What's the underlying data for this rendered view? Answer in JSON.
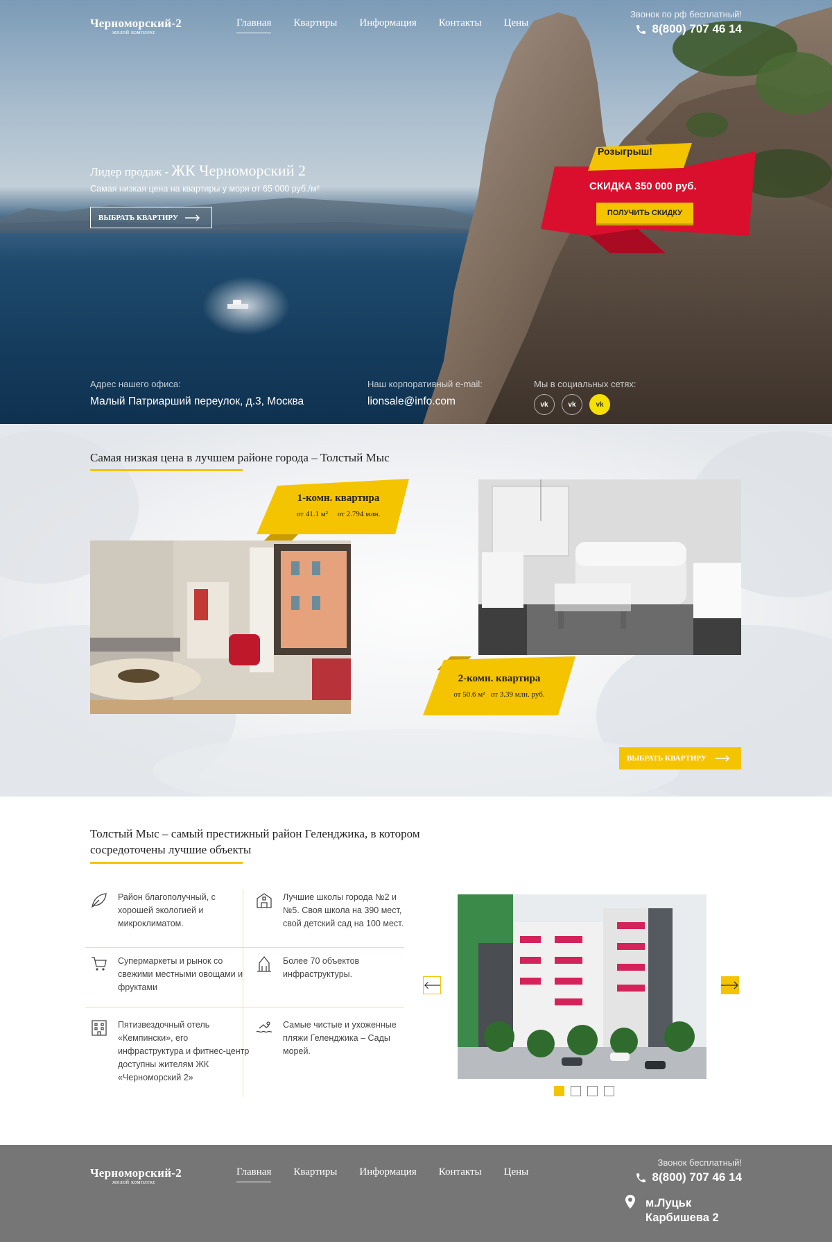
{
  "header": {
    "logo_main": "Черноморский-2",
    "logo_sub": "жилой комплекс",
    "nav": [
      "Главная",
      "Квартиры",
      "Информация",
      "Контакты",
      "Цены"
    ],
    "phone_caption": "Звонок по рф бесплатный!",
    "phone": "8(800) 707 46 14"
  },
  "hero": {
    "title_prefix": "Лидер продаж - ",
    "title_main": "ЖК Черноморский 2",
    "subtitle": "Самая низкая цена на квартиры у моря от 65 000 руб./м²",
    "cta": "ВЫБРАТЬ КВАРТИРУ",
    "promo_tag": "Розыгрыш!",
    "promo_discount": "СКИДКА 350 000 руб.",
    "promo_button": "ПОЛУЧИТЬ СКИДКУ",
    "office_label": "Адрес нашего офиса:",
    "office_value": "Малый Патриарший переулок, д.3, Москва",
    "email_label": "Наш корпоративный e-mail:",
    "email_value": "lionsale@info.com",
    "social_label": "Мы в социальных сетях:",
    "social": [
      "vk",
      "vk",
      "vk"
    ]
  },
  "offers": {
    "title": "Самая низкая цена в лучшем районе города – Толстый Мыс",
    "apt1_name": "1-комн. квартира",
    "apt1_price": "от 41.1 м²     от 2.794 млн.",
    "apt2_name": "2-комн. квартира",
    "apt2_price": "от 50.6 м²   от 3.39 млн. руб.",
    "cta": "ВЫБРАТЬ КВАРТИРУ"
  },
  "district": {
    "title_line1": "Толстый Мыс – самый престижный район Геленджика, в котором",
    "title_line2": "сосредоточены лучшие объекты",
    "features": [
      {
        "icon": "leaf-icon",
        "text": "Район благополучный, с хорошей экологией и микроклиматом."
      },
      {
        "icon": "school-icon",
        "text": "Лучшие школы города №2 и №5. Своя школа на 390 мест, свой детский сад на 100 мест."
      },
      {
        "icon": "cart-icon",
        "text": "Супермаркеты и рынок со свежими местными овощами и фруктами"
      },
      {
        "icon": "infrastructure-icon",
        "text": "Более 70 объектов инфраструктуры."
      },
      {
        "icon": "hotel-icon",
        "text": "Пятизвездочный отель «Кемпински», его инфраструктура и фитнес-центр доступны жителям ЖК «Черноморский 2»"
      },
      {
        "icon": "swimmer-icon",
        "text": "Самые чистые и ухоженные пляжи Геленджика – Сады морей."
      }
    ],
    "slides_total": 4,
    "slide_active": 1
  },
  "footer": {
    "logo_main": "Черноморский-2",
    "logo_sub": "жилой комплекс",
    "nav": [
      "Главная",
      "Квартиры",
      "Информация",
      "Контакты",
      "Цены"
    ],
    "phone_caption": "Звонок  бесплатный!",
    "phone": "8(800) 707 46 14",
    "address_line1": "м.Луцьк",
    "address_line2": "Карбишева 2"
  },
  "colors": {
    "accent": "#f5c400",
    "promo_red": "#d90f2d",
    "footer_bg": "#767676"
  }
}
